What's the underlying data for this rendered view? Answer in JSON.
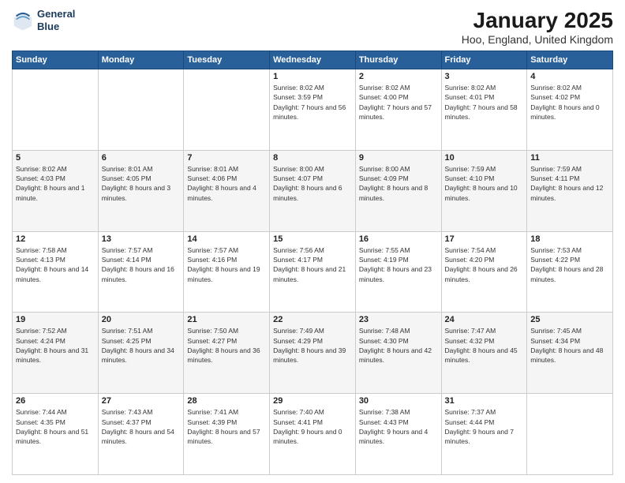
{
  "header": {
    "logo_line1": "General",
    "logo_line2": "Blue",
    "title": "January 2025",
    "subtitle": "Hoo, England, United Kingdom"
  },
  "columns": [
    "Sunday",
    "Monday",
    "Tuesday",
    "Wednesday",
    "Thursday",
    "Friday",
    "Saturday"
  ],
  "weeks": [
    [
      {
        "day": "",
        "info": ""
      },
      {
        "day": "",
        "info": ""
      },
      {
        "day": "",
        "info": ""
      },
      {
        "day": "1",
        "info": "Sunrise: 8:02 AM\nSunset: 3:59 PM\nDaylight: 7 hours and 56 minutes."
      },
      {
        "day": "2",
        "info": "Sunrise: 8:02 AM\nSunset: 4:00 PM\nDaylight: 7 hours and 57 minutes."
      },
      {
        "day": "3",
        "info": "Sunrise: 8:02 AM\nSunset: 4:01 PM\nDaylight: 7 hours and 58 minutes."
      },
      {
        "day": "4",
        "info": "Sunrise: 8:02 AM\nSunset: 4:02 PM\nDaylight: 8 hours and 0 minutes."
      }
    ],
    [
      {
        "day": "5",
        "info": "Sunrise: 8:02 AM\nSunset: 4:03 PM\nDaylight: 8 hours and 1 minute."
      },
      {
        "day": "6",
        "info": "Sunrise: 8:01 AM\nSunset: 4:05 PM\nDaylight: 8 hours and 3 minutes."
      },
      {
        "day": "7",
        "info": "Sunrise: 8:01 AM\nSunset: 4:06 PM\nDaylight: 8 hours and 4 minutes."
      },
      {
        "day": "8",
        "info": "Sunrise: 8:00 AM\nSunset: 4:07 PM\nDaylight: 8 hours and 6 minutes."
      },
      {
        "day": "9",
        "info": "Sunrise: 8:00 AM\nSunset: 4:09 PM\nDaylight: 8 hours and 8 minutes."
      },
      {
        "day": "10",
        "info": "Sunrise: 7:59 AM\nSunset: 4:10 PM\nDaylight: 8 hours and 10 minutes."
      },
      {
        "day": "11",
        "info": "Sunrise: 7:59 AM\nSunset: 4:11 PM\nDaylight: 8 hours and 12 minutes."
      }
    ],
    [
      {
        "day": "12",
        "info": "Sunrise: 7:58 AM\nSunset: 4:13 PM\nDaylight: 8 hours and 14 minutes."
      },
      {
        "day": "13",
        "info": "Sunrise: 7:57 AM\nSunset: 4:14 PM\nDaylight: 8 hours and 16 minutes."
      },
      {
        "day": "14",
        "info": "Sunrise: 7:57 AM\nSunset: 4:16 PM\nDaylight: 8 hours and 19 minutes."
      },
      {
        "day": "15",
        "info": "Sunrise: 7:56 AM\nSunset: 4:17 PM\nDaylight: 8 hours and 21 minutes."
      },
      {
        "day": "16",
        "info": "Sunrise: 7:55 AM\nSunset: 4:19 PM\nDaylight: 8 hours and 23 minutes."
      },
      {
        "day": "17",
        "info": "Sunrise: 7:54 AM\nSunset: 4:20 PM\nDaylight: 8 hours and 26 minutes."
      },
      {
        "day": "18",
        "info": "Sunrise: 7:53 AM\nSunset: 4:22 PM\nDaylight: 8 hours and 28 minutes."
      }
    ],
    [
      {
        "day": "19",
        "info": "Sunrise: 7:52 AM\nSunset: 4:24 PM\nDaylight: 8 hours and 31 minutes."
      },
      {
        "day": "20",
        "info": "Sunrise: 7:51 AM\nSunset: 4:25 PM\nDaylight: 8 hours and 34 minutes."
      },
      {
        "day": "21",
        "info": "Sunrise: 7:50 AM\nSunset: 4:27 PM\nDaylight: 8 hours and 36 minutes."
      },
      {
        "day": "22",
        "info": "Sunrise: 7:49 AM\nSunset: 4:29 PM\nDaylight: 8 hours and 39 minutes."
      },
      {
        "day": "23",
        "info": "Sunrise: 7:48 AM\nSunset: 4:30 PM\nDaylight: 8 hours and 42 minutes."
      },
      {
        "day": "24",
        "info": "Sunrise: 7:47 AM\nSunset: 4:32 PM\nDaylight: 8 hours and 45 minutes."
      },
      {
        "day": "25",
        "info": "Sunrise: 7:45 AM\nSunset: 4:34 PM\nDaylight: 8 hours and 48 minutes."
      }
    ],
    [
      {
        "day": "26",
        "info": "Sunrise: 7:44 AM\nSunset: 4:35 PM\nDaylight: 8 hours and 51 minutes."
      },
      {
        "day": "27",
        "info": "Sunrise: 7:43 AM\nSunset: 4:37 PM\nDaylight: 8 hours and 54 minutes."
      },
      {
        "day": "28",
        "info": "Sunrise: 7:41 AM\nSunset: 4:39 PM\nDaylight: 8 hours and 57 minutes."
      },
      {
        "day": "29",
        "info": "Sunrise: 7:40 AM\nSunset: 4:41 PM\nDaylight: 9 hours and 0 minutes."
      },
      {
        "day": "30",
        "info": "Sunrise: 7:38 AM\nSunset: 4:43 PM\nDaylight: 9 hours and 4 minutes."
      },
      {
        "day": "31",
        "info": "Sunrise: 7:37 AM\nSunset: 4:44 PM\nDaylight: 9 hours and 7 minutes."
      },
      {
        "day": "",
        "info": ""
      }
    ]
  ]
}
